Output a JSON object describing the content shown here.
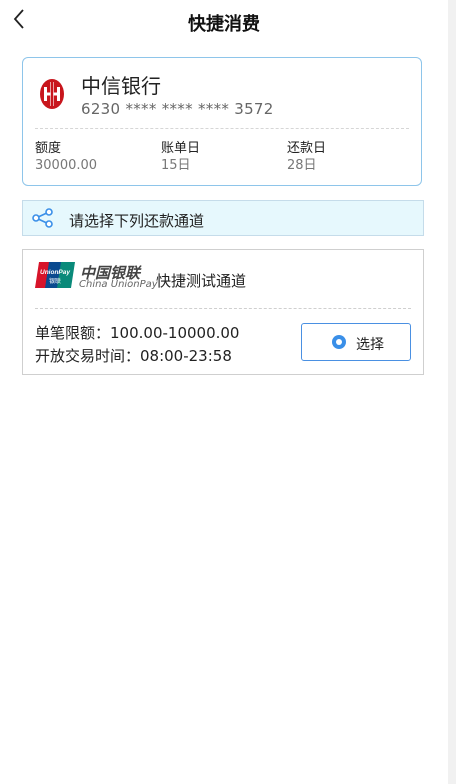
{
  "header": {
    "title": "快捷消费",
    "back_icon": "chevron-left-icon"
  },
  "card": {
    "bank_name": "中信银行",
    "bank_logo_color": "#c8161d",
    "card_number": "6230 **** **** **** 3572",
    "info": [
      {
        "label": "额度",
        "value": "30000.00"
      },
      {
        "label": "账单日",
        "value": "15日"
      },
      {
        "label": "还款日",
        "value": "28日"
      }
    ]
  },
  "notice": {
    "icon": "share-icon",
    "text": "请选择下列还款通道",
    "icon_color": "#3a8fe8"
  },
  "channel": {
    "logo_cn": "中国银联",
    "logo_en": "China UnionPay",
    "name": "快捷测试通道",
    "limit_text": "单笔限额：100.00-10000.00",
    "time_text": "开放交易时间：08:00-23:58",
    "select_label": "选择",
    "accent_color": "#4a90e2"
  }
}
